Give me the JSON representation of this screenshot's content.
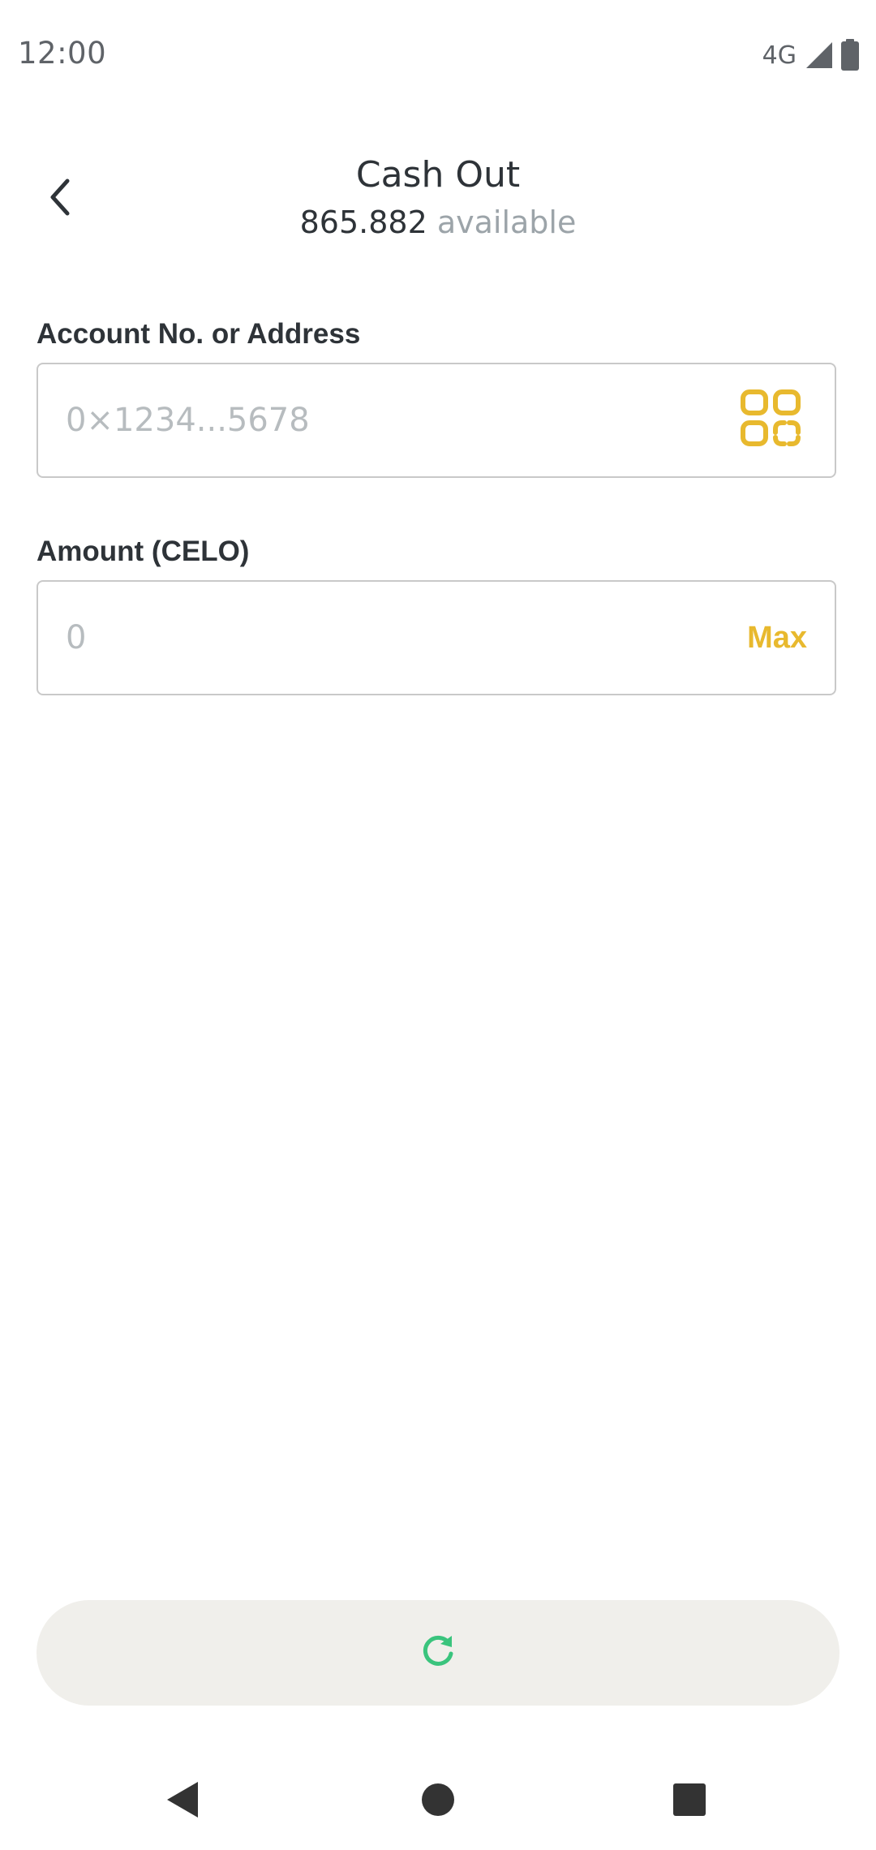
{
  "status_bar": {
    "time": "12:00",
    "network": "4G"
  },
  "header": {
    "title": "Cash Out",
    "balance_value": "865.882",
    "balance_suffix": "available"
  },
  "form": {
    "address": {
      "label": "Account No. or Address",
      "placeholder": "0×1234...5678",
      "value": "",
      "icon": "qr-scan-icon"
    },
    "amount": {
      "label": "Amount (CELO)",
      "placeholder": "0",
      "value": "",
      "max_label": "Max"
    }
  },
  "action_button": {
    "icon": "refresh-icon",
    "icon_color": "#3ac47d",
    "background": "#f0efeb"
  },
  "colors": {
    "accent": "#e8b92e",
    "text_primary": "#2e3338",
    "text_muted": "#9ca4a9"
  },
  "nav_bar": {
    "items": [
      "back-triangle-icon",
      "home-circle-icon",
      "recents-square-icon"
    ]
  }
}
